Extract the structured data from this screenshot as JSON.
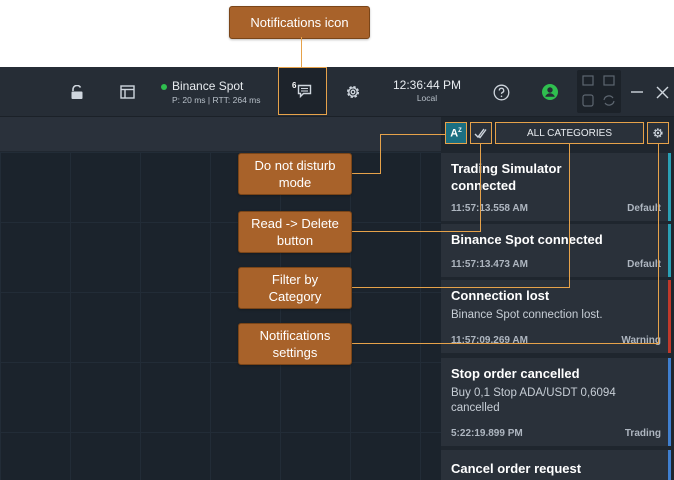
{
  "callouts": {
    "notifications_icon": "Notifications icon",
    "do_not_disturb": "Do not disturb mode",
    "read_delete": "Read -> Delete button",
    "filter_category": "Filter by Category",
    "notifications_settings": "Notifications settings"
  },
  "header": {
    "connection": {
      "name": "Binance Spot",
      "stats": "P: 20 ms | RTT: 264 ms",
      "status_color": "#2fbf4f"
    },
    "notifications_count": "6",
    "clock": {
      "time": "12:36:44 PM",
      "zone": "Local"
    },
    "icons": [
      "lock-icon",
      "layout-icon",
      "notifications-icon",
      "settings-gear-icon",
      "help-icon",
      "user-avatar-icon",
      "trading-tools-icon",
      "minimize-icon",
      "close-icon"
    ]
  },
  "panel": {
    "category_filter": "ALL CATEGORIES",
    "accent_color": "#e6a24a",
    "notifications": [
      {
        "title": "Trading Simulator connected",
        "body": "",
        "time": "11:57:13.558 AM",
        "category": "Default",
        "stripe": "#2aa0b5"
      },
      {
        "title": "Binance Spot connected",
        "body": "",
        "time": "11:57:13.473 AM",
        "category": "Default",
        "stripe": "#2aa0b5"
      },
      {
        "title": "Connection lost",
        "body": "Binance Spot connection lost.",
        "time": "11:57:09.269 AM",
        "category": "Warning",
        "stripe": "#c0392b"
      },
      {
        "title": "Stop order cancelled",
        "body": "Buy 0,1 Stop ADA/USDT 0,6094 cancelled",
        "time": "5:22:19.899 PM",
        "category": "Trading",
        "stripe": "#3f7fcf"
      },
      {
        "title": "Cancel order request",
        "body": "",
        "time": "",
        "category": "",
        "stripe": "#3f7fcf"
      }
    ]
  }
}
